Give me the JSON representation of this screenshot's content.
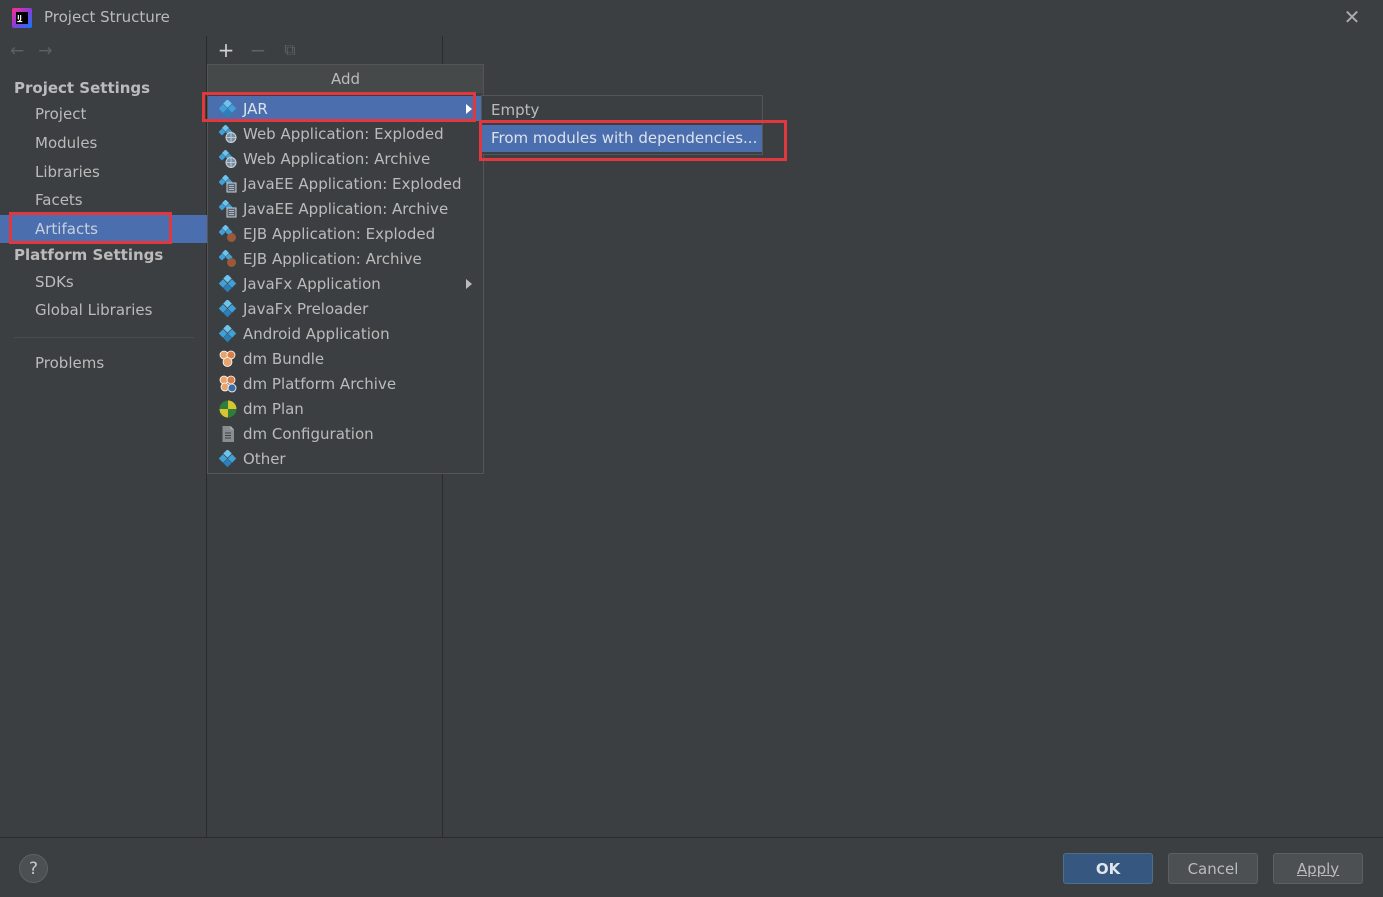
{
  "window": {
    "title": "Project Structure",
    "close_glyph": "✕",
    "app_icon_letters": "IJ"
  },
  "sidebar": {
    "back_glyph": "←",
    "forward_glyph": "→",
    "project_settings_header": "Project Settings",
    "project_items": [
      {
        "label": "Project"
      },
      {
        "label": "Modules"
      },
      {
        "label": "Libraries"
      },
      {
        "label": "Facets"
      },
      {
        "label": "Artifacts",
        "selected": true
      }
    ],
    "platform_settings_header": "Platform Settings",
    "platform_items": [
      {
        "label": "SDKs"
      },
      {
        "label": "Global Libraries"
      }
    ],
    "problems_label": "Problems"
  },
  "toolbar": {
    "add_glyph": "+",
    "remove_glyph": "−",
    "copy_glyph": "⧉"
  },
  "add_popup": {
    "title": "Add",
    "items": [
      {
        "label": "JAR",
        "icon": "artifact-icon",
        "selected": true,
        "has_submenu": true
      },
      {
        "label": "Web Application: Exploded",
        "icon": "web-artifact-icon"
      },
      {
        "label": "Web Application: Archive",
        "icon": "web-artifact-icon"
      },
      {
        "label": "JavaEE Application: Exploded",
        "icon": "javaee-artifact-icon"
      },
      {
        "label": "JavaEE Application: Archive",
        "icon": "javaee-artifact-icon"
      },
      {
        "label": "EJB Application: Exploded",
        "icon": "ejb-artifact-icon"
      },
      {
        "label": "EJB Application: Archive",
        "icon": "ejb-artifact-icon"
      },
      {
        "label": "JavaFx Application",
        "icon": "artifact-icon",
        "has_submenu": true
      },
      {
        "label": "JavaFx Preloader",
        "icon": "artifact-icon"
      },
      {
        "label": "Android Application",
        "icon": "artifact-icon"
      },
      {
        "label": "dm Bundle",
        "icon": "dm-bundle-icon"
      },
      {
        "label": "dm Platform Archive",
        "icon": "dm-platform-icon"
      },
      {
        "label": "dm Plan",
        "icon": "dm-plan-icon"
      },
      {
        "label": "dm Configuration",
        "icon": "dm-config-icon"
      },
      {
        "label": "Other",
        "icon": "artifact-icon"
      }
    ]
  },
  "jar_submenu": {
    "items": [
      {
        "label": "Empty"
      },
      {
        "label": "From modules with dependencies...",
        "selected": true
      }
    ]
  },
  "footer": {
    "help_glyph": "?",
    "ok_label": "OK",
    "cancel_label": "Cancel",
    "apply_label": "Apply"
  },
  "colors": {
    "background": "#3c3f41",
    "selection": "#4b6eaf",
    "highlight_box": "#e0383e",
    "primary_button": "#365880"
  }
}
